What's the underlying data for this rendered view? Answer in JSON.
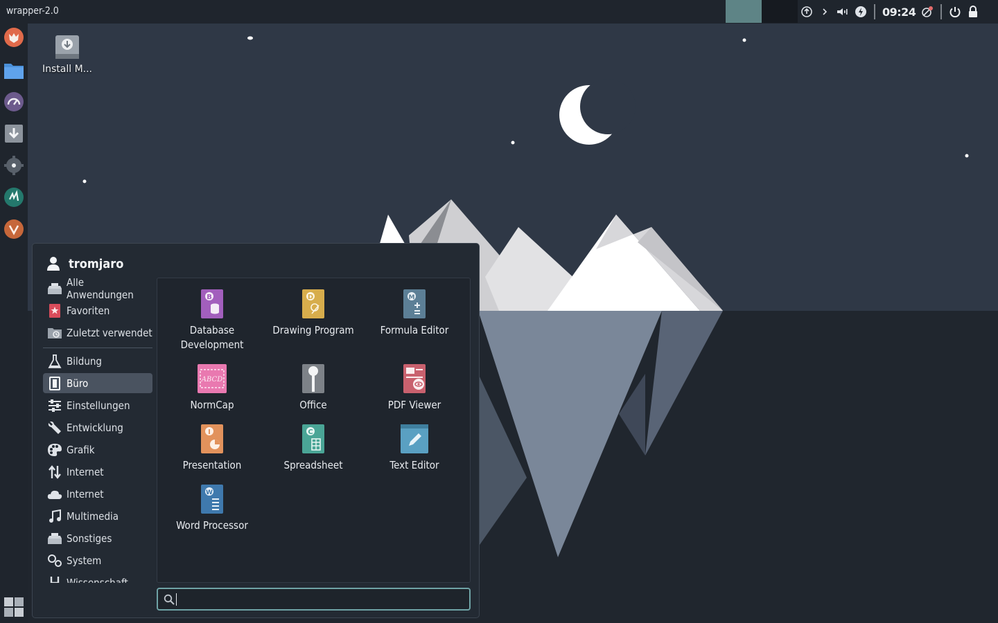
{
  "window": {
    "title": "wrapper-2.0"
  },
  "tray": {
    "clock": "09:24"
  },
  "desktop": {
    "icons": [
      {
        "label": "Install M..."
      }
    ]
  },
  "menu": {
    "user": "tromjaro",
    "categories": [
      {
        "label": "Alle Anwendungen",
        "icon": "apps-stack-icon"
      },
      {
        "label": "Favoriten",
        "icon": "favorites-star-icon"
      },
      {
        "label": "Zuletzt verwendet",
        "icon": "recent-folder-icon"
      },
      {
        "label": "Bildung",
        "icon": "flask-icon"
      },
      {
        "label": "Büro",
        "icon": "office-document-icon"
      },
      {
        "label": "Einstellungen",
        "icon": "sliders-icon"
      },
      {
        "label": "Entwicklung",
        "icon": "wrench-icon"
      },
      {
        "label": "Grafik",
        "icon": "palette-icon"
      },
      {
        "label": "Internet",
        "icon": "transfer-arrows-icon"
      },
      {
        "label": "Internet",
        "icon": "cloud-icon"
      },
      {
        "label": "Multimedia",
        "icon": "music-note-icon"
      },
      {
        "label": "Sonstiges",
        "icon": "misc-stack-icon"
      },
      {
        "label": "System",
        "icon": "gears-icon"
      },
      {
        "label": "Wissenschaft",
        "icon": "science-icon"
      }
    ],
    "active_category": "Büro",
    "apps": [
      {
        "label": "Database Development",
        "icon": "database-icon"
      },
      {
        "label": "Drawing Program",
        "icon": "drawing-icon"
      },
      {
        "label": "Formula Editor",
        "icon": "formula-icon"
      },
      {
        "label": "NormCap",
        "icon": "normcap-icon"
      },
      {
        "label": "Office",
        "icon": "office-icon"
      },
      {
        "label": "PDF Viewer",
        "icon": "pdf-viewer-icon"
      },
      {
        "label": "Presentation",
        "icon": "presentation-icon"
      },
      {
        "label": "Spreadsheet",
        "icon": "spreadsheet-icon"
      },
      {
        "label": "Text Editor",
        "icon": "text-editor-icon"
      },
      {
        "label": "Word Processor",
        "icon": "word-processor-icon"
      }
    ],
    "search": {
      "value": "",
      "placeholder": ""
    }
  },
  "colors": {
    "panel": "#1f252d",
    "accent": "#6fa3a6",
    "sky": "#2f3846",
    "ground": "#20262e"
  }
}
